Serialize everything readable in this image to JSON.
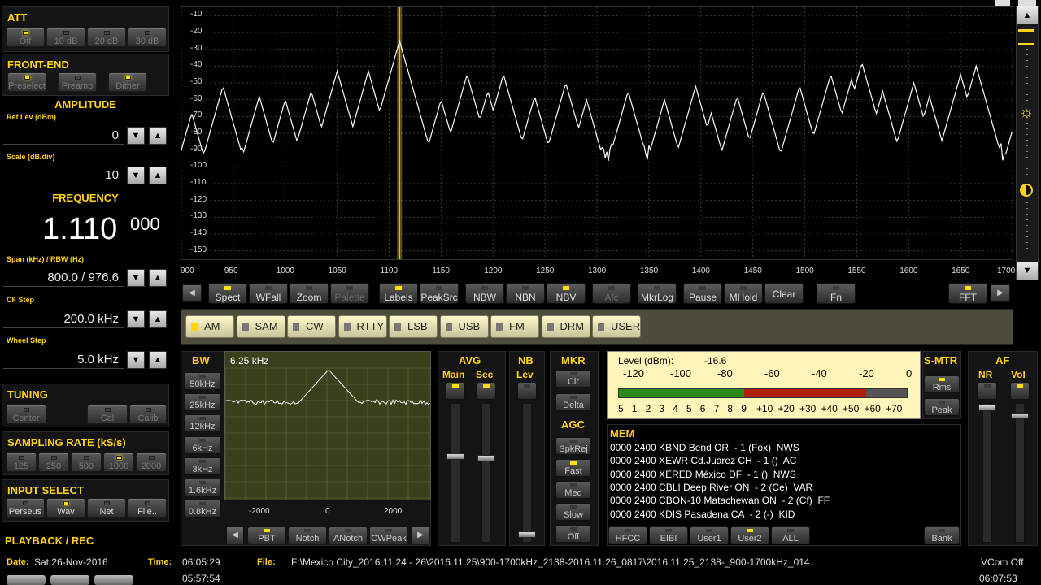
{
  "att": {
    "title": "ATT",
    "buttons": [
      {
        "label": "Off",
        "on": true
      },
      {
        "label": "10 dB",
        "on": false
      },
      {
        "label": "20 dB",
        "on": false
      },
      {
        "label": "30 dB",
        "on": false
      }
    ]
  },
  "frontend": {
    "title": "FRONT-END",
    "buttons": [
      {
        "label": "Preselect",
        "on": true
      },
      {
        "label": "Preamp",
        "on": false
      },
      {
        "label": "Dither",
        "on": true
      }
    ]
  },
  "amplitude": {
    "title": "AMPLITUDE",
    "ref_label": "Ref Lev (dBm)",
    "ref_value": "0",
    "scale_label": "Scale (dB/div)",
    "scale_value": "10"
  },
  "frequency": {
    "title": "FREQUENCY",
    "main": "1.110",
    "sub": "000",
    "span_label": "Span (kHz) / RBW (Hz)",
    "span_value": "800.0 / 976.6",
    "cf_label": "CF Step",
    "cf_value": "200.0 kHz",
    "wheel_label": "Wheel Step",
    "wheel_value": "5.0 kHz"
  },
  "tuning": {
    "title": "TUNING",
    "buttons": [
      "Center",
      "Cal",
      "Calib"
    ]
  },
  "sampling": {
    "title": "SAMPLING RATE (kS/s)",
    "buttons": [
      {
        "label": "125",
        "on": false
      },
      {
        "label": "250",
        "on": false
      },
      {
        "label": "500",
        "on": false
      },
      {
        "label": "1000",
        "on": true
      },
      {
        "label": "2000",
        "on": false
      }
    ]
  },
  "input": {
    "title": "INPUT SELECT",
    "buttons": [
      {
        "label": "Perseus",
        "on": false
      },
      {
        "label": "Wav",
        "on": true
      },
      {
        "label": "Net",
        "on": false
      },
      {
        "label": "File..",
        "on": false
      }
    ]
  },
  "playback": {
    "title": "PLAYBACK / REC"
  },
  "spectrum": {
    "y_ticks": [
      "-10",
      "-20",
      "-30",
      "-40",
      "-50",
      "-60",
      "-70",
      "-80",
      "-90",
      "-100",
      "-110",
      "-120",
      "-130",
      "-140",
      "-150"
    ],
    "x_ticks": [
      "900",
      "950",
      "1000",
      "1050",
      "1100",
      "1150",
      "1200",
      "1250",
      "1300",
      "1350",
      "1400",
      "1450",
      "1500",
      "1550",
      "1600",
      "1650",
      "1700"
    ],
    "xlim": [
      900,
      1700
    ],
    "ylim": [
      -155,
      -5
    ],
    "cursor_khz": 1110,
    "peaks": [
      [
        910,
        -68
      ],
      [
        940,
        -52
      ],
      [
        975,
        -58
      ],
      [
        1000,
        -60
      ],
      [
        1025,
        -55
      ],
      [
        1050,
        -43
      ],
      [
        1080,
        -43
      ],
      [
        1110,
        -25
      ],
      [
        1150,
        -60
      ],
      [
        1175,
        -45
      ],
      [
        1195,
        -55
      ],
      [
        1210,
        -45
      ],
      [
        1240,
        -58
      ],
      [
        1270,
        -50
      ],
      [
        1290,
        -60
      ],
      [
        1330,
        -55
      ],
      [
        1365,
        -60
      ],
      [
        1395,
        -52
      ],
      [
        1410,
        -68
      ],
      [
        1435,
        -58
      ],
      [
        1460,
        -55
      ],
      [
        1495,
        -52
      ],
      [
        1525,
        -45
      ],
      [
        1545,
        -48
      ],
      [
        1555,
        -38
      ],
      [
        1575,
        -55
      ],
      [
        1605,
        -50
      ],
      [
        1620,
        -58
      ],
      [
        1650,
        -45
      ],
      [
        1665,
        -40
      ],
      [
        1700,
        -78
      ]
    ],
    "noise_floor": -92
  },
  "toolbar": [
    {
      "label": "Spect",
      "on": true,
      "x": 256
    },
    {
      "label": "WFall",
      "on": false,
      "x": 306
    },
    {
      "label": "Zoom",
      "on": false,
      "x": 356
    },
    {
      "label": "Palette",
      "on": false,
      "x": 406,
      "dim": true
    },
    {
      "label": "Labels",
      "on": true,
      "x": 466
    },
    {
      "label": "PeakSrc",
      "on": false,
      "x": 516
    },
    {
      "label": "NBW",
      "on": false,
      "x": 572
    },
    {
      "label": "NBN",
      "on": false,
      "x": 622
    },
    {
      "label": "NBV",
      "on": true,
      "x": 672
    },
    {
      "label": "Afc",
      "on": false,
      "x": 728,
      "dim": true
    },
    {
      "label": "MkrLog",
      "on": false,
      "x": 784
    },
    {
      "label": "Pause",
      "on": false,
      "x": 840
    },
    {
      "label": "MHold",
      "on": false,
      "x": 890
    },
    {
      "label": "Clear",
      "on": false,
      "x": 940
    },
    {
      "label": "Fn",
      "on": false,
      "x": 1004
    },
    {
      "label": "FFT",
      "on": true,
      "x": 1166
    }
  ],
  "modes": [
    {
      "label": "AM",
      "on": true
    },
    {
      "label": "SAM",
      "on": false
    },
    {
      "label": "CW",
      "on": false
    },
    {
      "label": "RTTY",
      "on": false
    },
    {
      "label": "LSB",
      "on": false
    },
    {
      "label": "USB",
      "on": false
    },
    {
      "label": "FM",
      "on": false
    },
    {
      "label": "DRM",
      "on": false
    },
    {
      "label": "USER",
      "on": false
    }
  ],
  "bw": {
    "title": "BW",
    "readout": "6.25 kHz",
    "buttons": [
      "50kHz",
      "25kHz",
      "12kHz",
      "6kHz",
      "3kHz",
      "1.6kHz",
      "0.8kHz"
    ],
    "x_ticks": [
      "-2000",
      "0",
      "2000"
    ],
    "bottom": [
      {
        "label": "PBT",
        "on": true
      },
      {
        "label": "Notch",
        "on": false
      },
      {
        "label": "ANotch",
        "on": false
      },
      {
        "label": "CWPeak",
        "on": false
      }
    ]
  },
  "avg": {
    "title": "AVG",
    "main": "Main",
    "sec": "Sec"
  },
  "nb": {
    "title": "NB",
    "lev": "Lev"
  },
  "mkr": {
    "title": "MKR",
    "clr": "Clr",
    "delta": "Delta"
  },
  "agc": {
    "title": "AGC",
    "buttons": [
      {
        "label": "SpkRej",
        "on": false
      },
      {
        "label": "Fast",
        "on": true
      },
      {
        "label": "Med",
        "on": false
      },
      {
        "label": "Slow",
        "on": false
      },
      {
        "label": "Off",
        "on": false
      }
    ]
  },
  "smeter": {
    "level_label": "Level (dBm):",
    "level_value": "-16.6",
    "top_ticks": [
      "-120",
      "-100",
      "-80",
      "-60",
      "-40",
      "-20",
      "0"
    ],
    "bottom_ticks": [
      "5",
      "1",
      "2",
      "3",
      "4",
      "5",
      "6",
      "7",
      "8",
      "9",
      "+10",
      "+20",
      "+30",
      "+40",
      "+50",
      "+60",
      "+70"
    ],
    "fraction": 0.86
  },
  "smtr": {
    "title": "S-MTR",
    "rms": "Rms",
    "peak": "Peak"
  },
  "af": {
    "title": "AF",
    "nr": "NR",
    "vol": "Vol"
  },
  "mem": {
    "title": "MEM",
    "rows": [
      "0000 2400 KBND Bend OR  - 1 (Fox)  NWS",
      "0000 2400 XEWR Cd.Juarez CH  - 1 ()  AC",
      "0000 2400 XERED México DF  - 1 ()  NWS",
      "0000 2400 CBLI Deep River ON  - 2 (Ce)  VAR",
      "0000 2400 CBON-10 Matachewan ON  - 2 (Cf)  FF",
      "0000 2400 KDIS Pasadena CA  - 2 (-)  KID"
    ],
    "buttons": [
      {
        "label": "HFCC",
        "on": false
      },
      {
        "label": "EIBI",
        "on": false
      },
      {
        "label": "User1",
        "on": false
      },
      {
        "label": "User2",
        "on": true
      },
      {
        "label": "ALL",
        "on": false
      }
    ],
    "bank": "Bank"
  },
  "status": {
    "date_label": "Date:",
    "date": "Sat 26-Nov-2016",
    "time_label": "Time:",
    "time": "06:05:29",
    "time2": "05:57:54",
    "file_label": "File:",
    "file": "F:\\Mexico City_2016.11.24 - 26\\2016.11.25\\900-1700kHz_2138-2016.11.26_0817\\2016.11.25_2138-_900-1700kHz_014.",
    "vcom": "VCom Off",
    "end_time": "06:07:53"
  }
}
